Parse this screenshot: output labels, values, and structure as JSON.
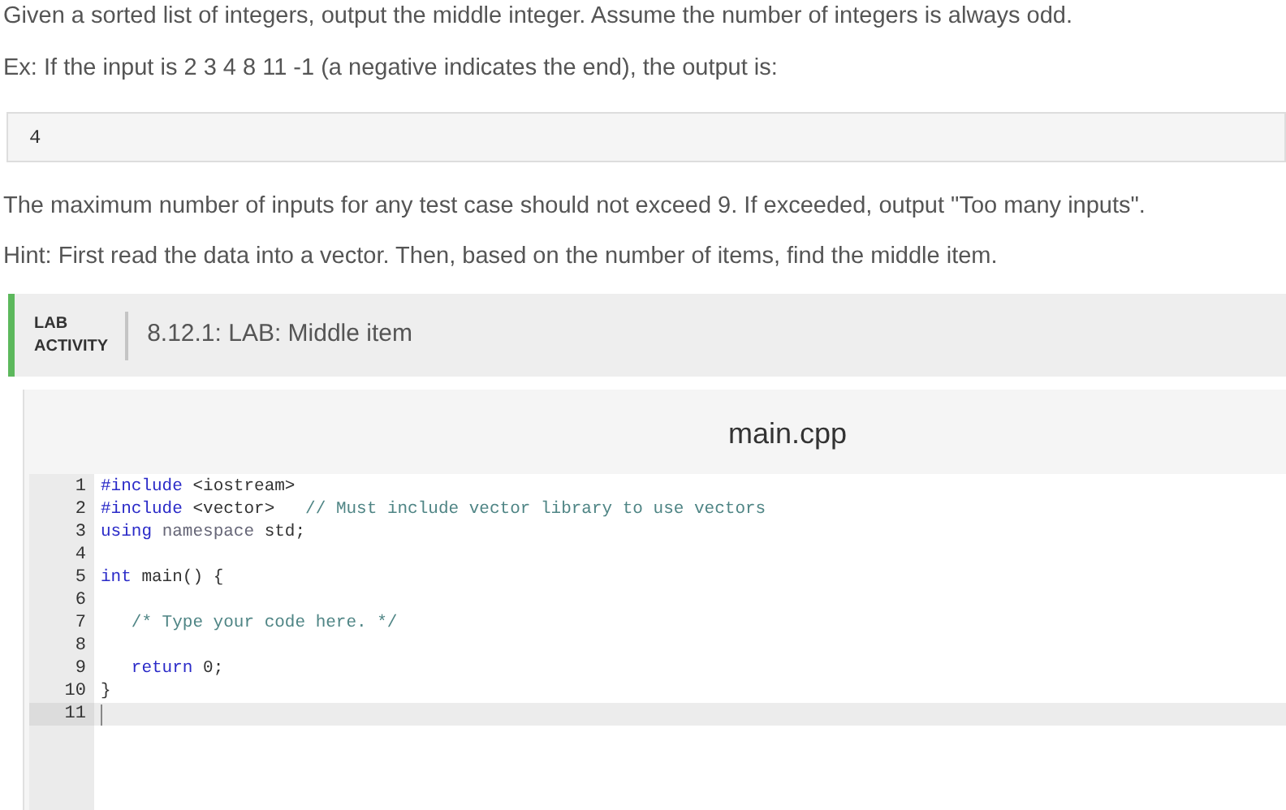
{
  "intro": [
    "Given a sorted list of integers, output the middle integer. Assume the number of integers is always odd.",
    "Ex: If the input is 2 3 4 8 11 -1 (a negative indicates the end), the output is:"
  ],
  "output_example": "4",
  "notes": [
    "The maximum number of inputs for any test case should not exceed 9. If exceeded, output \"Too many inputs\".",
    "Hint: First read the data into a vector. Then, based on the number of items, find the middle item."
  ],
  "lab": {
    "label_lines": [
      "LAB",
      "ACTIVITY"
    ],
    "title": "8.12.1: LAB: Middle item"
  },
  "editor": {
    "filename": "main.cpp",
    "lines": [
      {
        "number": "1",
        "current": false,
        "tokens": [
          {
            "kind": "keyword",
            "text": "#include"
          },
          {
            "kind": "plain",
            "text": " <iostream>"
          }
        ]
      },
      {
        "number": "2",
        "current": false,
        "tokens": [
          {
            "kind": "keyword",
            "text": "#include"
          },
          {
            "kind": "plain",
            "text": " <vector>   "
          },
          {
            "kind": "comment",
            "text": "// Must include vector library to use vectors"
          }
        ]
      },
      {
        "number": "3",
        "current": false,
        "tokens": [
          {
            "kind": "keyword",
            "text": "using"
          },
          {
            "kind": "muted",
            "text": " namespace"
          },
          {
            "kind": "plain",
            "text": " std;"
          }
        ]
      },
      {
        "number": "4",
        "current": false
      },
      {
        "number": "5",
        "current": false,
        "tokens": [
          {
            "kind": "keyword",
            "text": "int"
          },
          {
            "kind": "plain",
            "text": " main() {"
          }
        ]
      },
      {
        "number": "6",
        "current": false
      },
      {
        "number": "7",
        "current": false,
        "tokens": [
          {
            "kind": "comment",
            "text": "   /* Type your code here. */"
          }
        ]
      },
      {
        "number": "8",
        "current": false
      },
      {
        "number": "9",
        "current": false,
        "tokens": [
          {
            "kind": "keyword",
            "text": "   return"
          },
          {
            "kind": "plain",
            "text": " 0;"
          }
        ]
      },
      {
        "number": "10",
        "current": false,
        "tokens": [
          {
            "kind": "plain",
            "text": "}"
          }
        ]
      },
      {
        "number": "11",
        "current": true
      }
    ]
  }
}
